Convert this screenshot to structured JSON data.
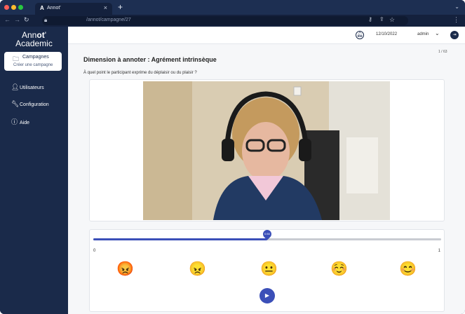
{
  "browser": {
    "tab_title": "Annot'",
    "tab_favicon": "A",
    "url": "/annot/campagne/27",
    "new_tab_icon": "+",
    "close_icon": "×"
  },
  "sidebar": {
    "logo_top": "Annot'",
    "logo_bottom": "Academic",
    "active_item": {
      "label": "Campagnes",
      "sub_label": "Créer une campagne"
    },
    "items": [
      {
        "label": "Utilisateurs",
        "icon": "user-icon"
      },
      {
        "label": "Configuration",
        "icon": "wrench-icon"
      },
      {
        "label": "Aide",
        "icon": "help-icon"
      }
    ]
  },
  "topbar": {
    "date": "12/10/2022",
    "user": "admin",
    "logout_icon": "logout-icon"
  },
  "content": {
    "counter": "1 / 63",
    "dimension_title": "Dimension à annoter : Agrément intrinsèque",
    "question": "À quel point le participant exprime du déplaisir ou du plaisir ?"
  },
  "slider": {
    "value": 0.5,
    "value_label": "0.50",
    "min_label": "0",
    "max_label": "1",
    "emojis": [
      "😡",
      "😠",
      "😐",
      "☺️",
      "😊"
    ]
  },
  "colors": {
    "sidebar": "#1a2a4a",
    "accent": "#3b4fb8"
  }
}
